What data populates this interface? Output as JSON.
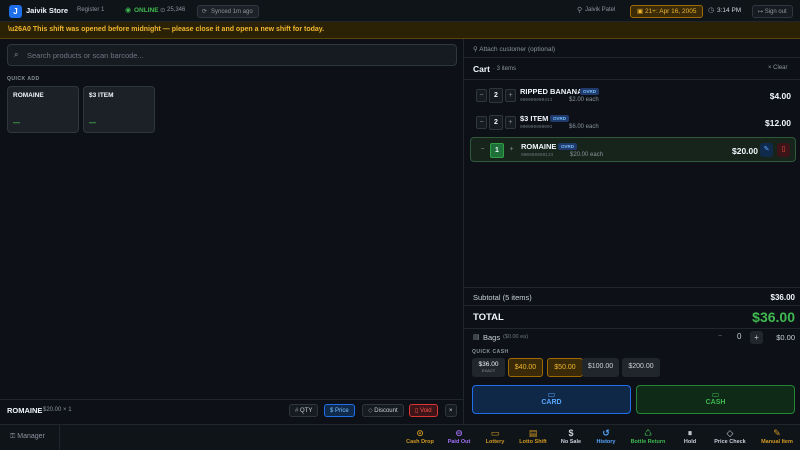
{
  "topbar": {
    "logo_glyph": "J",
    "store_name": "Jaivik Store",
    "register": "Register 1",
    "status": "ONLINE",
    "status_count": "25,346",
    "synced": "Synced 1m ago",
    "user": "Jaivik Patel",
    "age_check": "21+: Apr 16, 2005",
    "time": "3:14 PM",
    "sign_out": "Sign out"
  },
  "banner": {
    "text": "\\u26A0 This shift was opened before midnight — please close it and open a new shift for today."
  },
  "search": {
    "placeholder": "Search products or scan barcode..."
  },
  "quick_add": {
    "label": "QUICK ADD",
    "tiles": [
      {
        "name": "ROMAINE",
        "price": "—"
      },
      {
        "name": "$3 ITEM",
        "price": "—"
      }
    ]
  },
  "selected_item": {
    "name": "ROMAINE",
    "sub": "$20.00 × 1",
    "qty_label": "QTY",
    "price_label": "Price",
    "discount_label": "Discount",
    "void_label": "Void",
    "close_glyph": "×"
  },
  "customer": {
    "attach_label": "Attach customer (optional)"
  },
  "cart": {
    "title": "Cart",
    "count": "· 3 items",
    "clear_label": "Clear",
    "lines": [
      {
        "qty": "2",
        "name": "RIPPED BANANA",
        "badge": "OVRD",
        "barcode": "00000000041I",
        "each": "$2.00 each",
        "total": "$4.00"
      },
      {
        "qty": "2",
        "name": "$3 ITEM",
        "badge": "OVRD",
        "barcode": "00000000000I",
        "each": "$6.00 each",
        "total": "$12.00"
      },
      {
        "qty": "1",
        "name": "ROMAINE",
        "badge": "OVRD",
        "barcode": "00000000013I",
        "each": "$20.00 each",
        "total": "$20.00"
      }
    ]
  },
  "summary": {
    "subtotal_label": "Subtotal (5 items)",
    "subtotal_value": "$36.00",
    "total_label": "TOTAL",
    "total_value": "$36.00",
    "bags_label": "Bags",
    "bags_sub": "($0.00 ea)",
    "bags_qty": "0",
    "bags_value": "$0.00"
  },
  "quick_cash": {
    "label": "QUICK CASH",
    "exact_value": "$36.00",
    "exact_label": "EXACT",
    "options": [
      "$40.00",
      "$50.00",
      "$100.00",
      "$200.00"
    ]
  },
  "payment": {
    "card_label": "CARD",
    "cash_label": "CASH"
  },
  "toolbar": {
    "manager_label": "Manager",
    "tools": [
      {
        "label": "Cash Drop",
        "color": "#d29922"
      },
      {
        "label": "Paid Out",
        "color": "#a371f7"
      },
      {
        "label": "Lottery",
        "color": "#d29922"
      },
      {
        "label": "Lotto Shift",
        "color": "#d29922"
      },
      {
        "label": "No Sale",
        "color": "#c9d1d9"
      },
      {
        "label": "History",
        "color": "#58a6ff"
      },
      {
        "label": "Bottle Return",
        "color": "#3fb950"
      },
      {
        "label": "Hold",
        "color": "#c9d1d9"
      },
      {
        "label": "Price Check",
        "color": "#c9d1d9"
      },
      {
        "label": "Manual Item",
        "color": "#d29922"
      }
    ]
  },
  "colors": {
    "accent_blue": "#1f6feb",
    "success_green": "#3fb950",
    "warning_amber": "#f0b72f",
    "danger_red": "#f85149"
  }
}
